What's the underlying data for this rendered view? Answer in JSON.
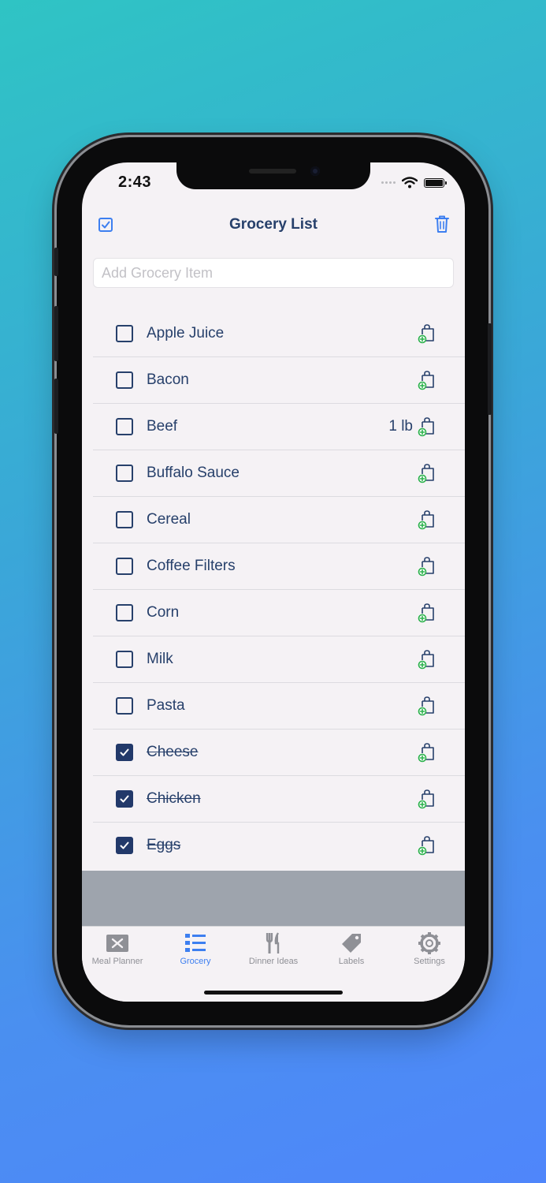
{
  "status": {
    "time": "2:43"
  },
  "navbar": {
    "title": "Grocery List",
    "left_icon": "checkbox-icon",
    "right_icon": "trash-icon"
  },
  "add_item": {
    "placeholder": "Add Grocery Item",
    "value": ""
  },
  "items": [
    {
      "name": "Apple Juice",
      "checked": false,
      "qty": ""
    },
    {
      "name": "Bacon",
      "checked": false,
      "qty": ""
    },
    {
      "name": "Beef",
      "checked": false,
      "qty": "1 lb"
    },
    {
      "name": "Buffalo Sauce",
      "checked": false,
      "qty": ""
    },
    {
      "name": "Cereal",
      "checked": false,
      "qty": ""
    },
    {
      "name": "Coffee Filters",
      "checked": false,
      "qty": ""
    },
    {
      "name": "Corn",
      "checked": false,
      "qty": ""
    },
    {
      "name": "Milk",
      "checked": false,
      "qty": ""
    },
    {
      "name": "Pasta",
      "checked": false,
      "qty": ""
    },
    {
      "name": "Cheese",
      "checked": true,
      "qty": ""
    },
    {
      "name": "Chicken",
      "checked": true,
      "qty": ""
    },
    {
      "name": "Eggs",
      "checked": true,
      "qty": ""
    }
  ],
  "tabs": [
    {
      "label": "Meal Planner",
      "icon": "meal-planner-icon",
      "active": false
    },
    {
      "label": "Grocery",
      "icon": "list-icon",
      "active": true
    },
    {
      "label": "Dinner Ideas",
      "icon": "fork-knife-icon",
      "active": false
    },
    {
      "label": "Labels",
      "icon": "tag-icon",
      "active": false
    },
    {
      "label": "Settings",
      "icon": "gear-icon",
      "active": false
    }
  ],
  "colors": {
    "accent": "#3d7ff0",
    "text": "#27406b",
    "add_green": "#2bb24c",
    "tab_inactive": "#8f9096"
  }
}
